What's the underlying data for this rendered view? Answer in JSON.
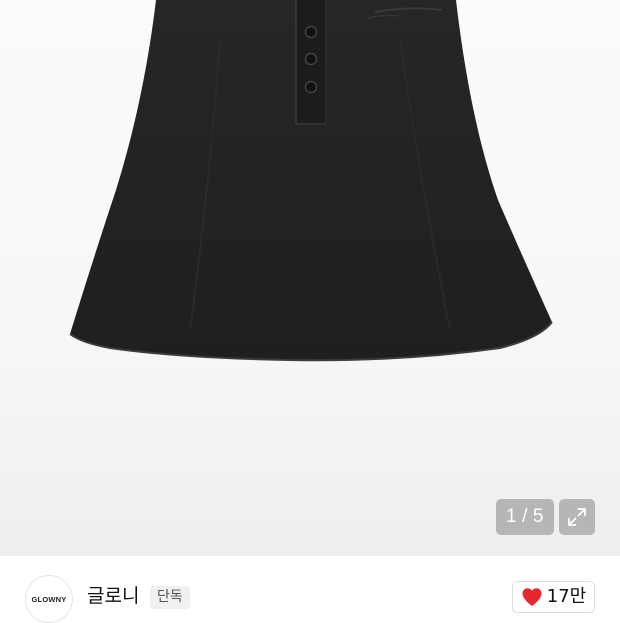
{
  "gallery": {
    "counter": {
      "current": "1",
      "separator": "/",
      "total": "5"
    }
  },
  "brand": {
    "logo_text": "GLOWNY",
    "name": "글로니",
    "badge": "단독"
  },
  "like": {
    "count": "17만",
    "liked": true,
    "color": "#e8262d"
  },
  "icons": {
    "expand": "expand-arrows-icon",
    "like": "heart-icon"
  },
  "product": {
    "color": "#232323"
  }
}
